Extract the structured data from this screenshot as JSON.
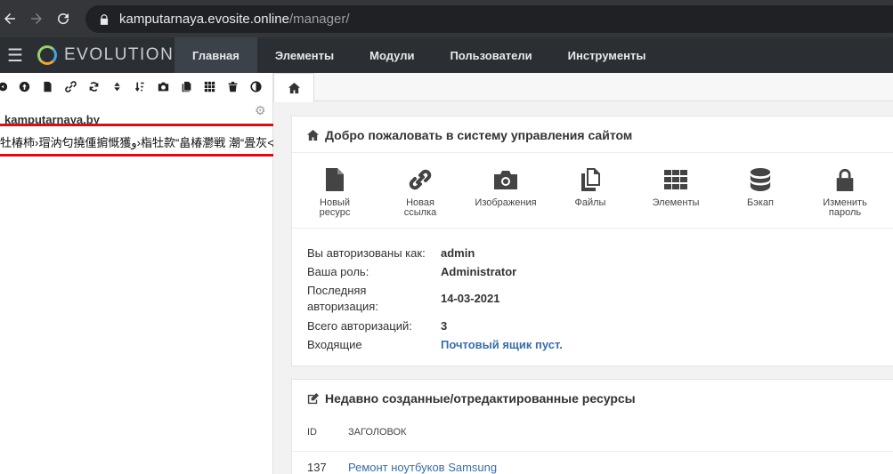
{
  "browser": {
    "url_host": "kamputarnaya.evosite.online",
    "url_path": "/manager/"
  },
  "header": {
    "logo_text": "EVOLUTION",
    "menu": [
      "Главная",
      "Элементы",
      "Модули",
      "Пользователи",
      "Инструменты"
    ],
    "active_index": 0
  },
  "tree": {
    "site_name": "kamputarnaya.by",
    "garbled_item": "牡椿柿›瑁汭匂撓偅掮慨獲ﻭ›栺牡款“畠椿灪戦 潮“畳灰≮",
    "toolbar_icons": [
      "expand-icon",
      "collapse-icon",
      "new-document-icon",
      "weblink-icon",
      "refresh-icon",
      "sort-icon",
      "sort-az-icon",
      "images-icon",
      "files-icon",
      "elements-icon",
      "trash-icon",
      "theme-icon"
    ]
  },
  "welcome": {
    "title": "Добро пожаловать в систему управления сайтом",
    "quick": [
      {
        "label": "Новый ресурс",
        "icon": "document-icon"
      },
      {
        "label": "Новая ссылка",
        "icon": "link-icon"
      },
      {
        "label": "Изображения",
        "icon": "camera-icon"
      },
      {
        "label": "Файлы",
        "icon": "files-icon"
      },
      {
        "label": "Элементы",
        "icon": "grid-icon"
      },
      {
        "label": "Бэкап",
        "icon": "database-icon"
      },
      {
        "label": "Изменить пароль",
        "icon": "lock-icon"
      }
    ],
    "info": {
      "auth_label": "Вы авторизованы как:",
      "auth_value": "admin",
      "role_label": "Ваша роль:",
      "role_value": "Administrator",
      "last_label_1": "Последняя",
      "last_label_2": "авторизация:",
      "last_value": "14-03-2021",
      "total_label": "Всего авторизаций:",
      "total_value": "3",
      "inbox_label": "Входящие",
      "inbox_value": "Почтовый ящик пуст."
    }
  },
  "recent": {
    "title": "Недавно созданные/отредактированные ресурсы",
    "col_id": "ID",
    "col_title": "ЗАГОЛОВОК",
    "rows": [
      {
        "id": "137",
        "title": "Ремонт ноутбуков Samsung"
      }
    ]
  }
}
